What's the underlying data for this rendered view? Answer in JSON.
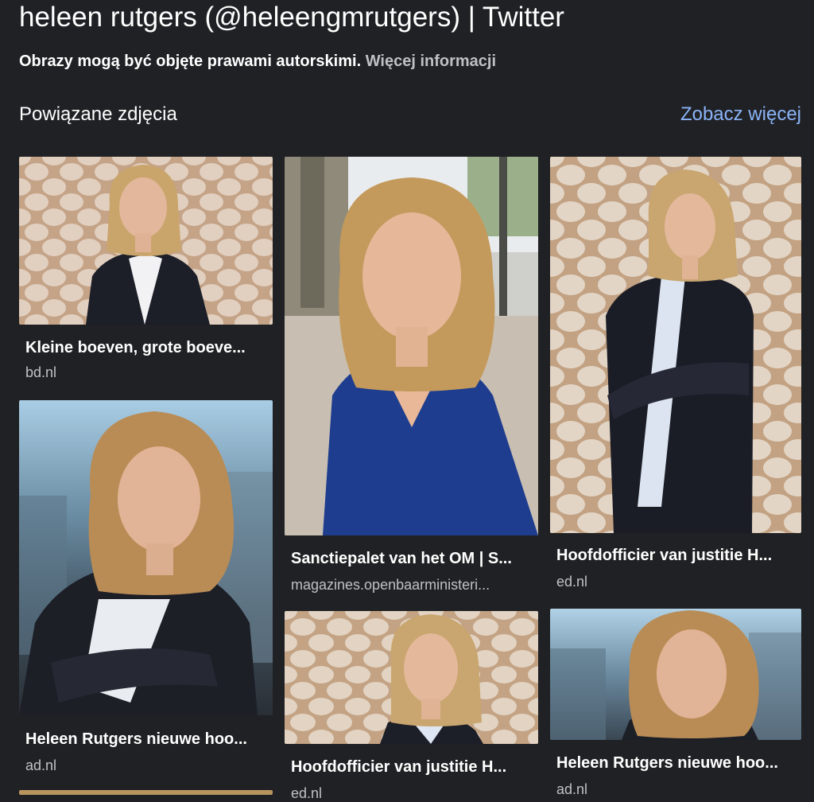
{
  "header": {
    "title": "heleen rutgers (@heleengmrutgers) | Twitter",
    "copyright_notice": "Obrazy mogą być objęte prawami autorskimi.",
    "more_info_link": "Więcej informacji"
  },
  "related": {
    "heading": "Powiązane zdjęcia",
    "see_more": "Zobacz więcej",
    "items": [
      {
        "caption": "Kleine boeven, grote boeve...",
        "source": "bd.nl"
      },
      {
        "caption": "Sanctiepalet van het OM | S...",
        "source": "magazines.openbaarministeri..."
      },
      {
        "caption": "Hoofdofficier van justitie H...",
        "source": "ed.nl"
      },
      {
        "caption": "Heleen Rutgers nieuwe hoo...",
        "source": "ad.nl"
      },
      {
        "caption": "Hoofdofficier van justitie H...",
        "source": "ed.nl"
      },
      {
        "caption": "Heleen Rutgers nieuwe hoo...",
        "source": "ad.nl"
      }
    ]
  },
  "colors": {
    "background": "#202124",
    "link": "#8ab4f8",
    "secondary_text": "#bdc1c6"
  }
}
